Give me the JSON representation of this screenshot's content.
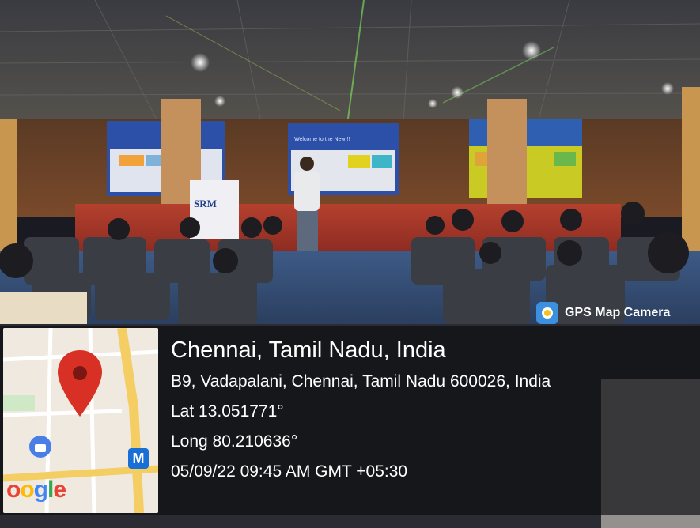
{
  "badge": {
    "label": "GPS Map Camera",
    "icon": "gps-map-camera-app-icon"
  },
  "location": {
    "city": "Chennai, Tamil Nadu, India",
    "address": "B9, Vadapalani, Chennai, Tamil Nadu 600026, India",
    "latitude": "Lat 13.051771°",
    "longitude": "Long 80.210636°",
    "datetime": "05/09/22 09:45 AM GMT +05:30"
  },
  "map": {
    "logo_text": "Google",
    "metro_label": "M",
    "pin_color": "#d93025"
  },
  "scene": {
    "podium_label": "SRM",
    "screen_text": "Welcome to the New !!"
  }
}
